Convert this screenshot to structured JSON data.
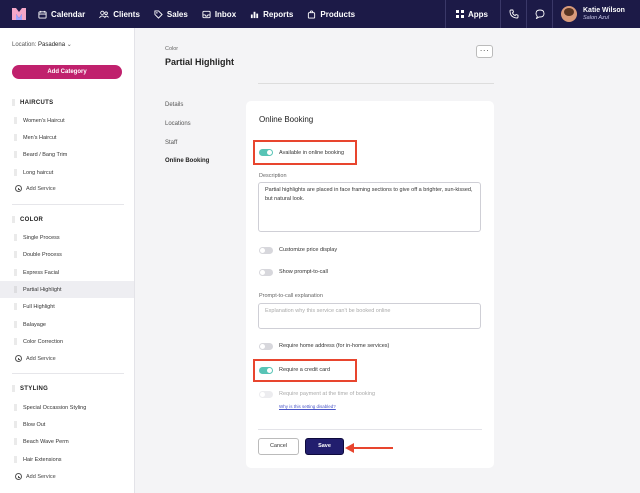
{
  "nav": {
    "items": [
      {
        "label": "Calendar",
        "icon": "calendar-icon"
      },
      {
        "label": "Clients",
        "icon": "clients-icon"
      },
      {
        "label": "Sales",
        "icon": "tag-icon"
      },
      {
        "label": "Inbox",
        "icon": "inbox-icon"
      },
      {
        "label": "Reports",
        "icon": "chart-icon"
      },
      {
        "label": "Products",
        "icon": "bag-icon"
      }
    ],
    "apps_label": "Apps",
    "user_name": "Katie Wilson",
    "user_business": "Salon Azul"
  },
  "sidebar": {
    "location_label": "Location:",
    "location_value": "Pasadena",
    "add_category": "Add Category",
    "add_service": "Add Service",
    "groups": [
      {
        "title": "HAIRCUTS",
        "items": [
          "Women's Haircut",
          "Men's Haircut",
          "Beard / Bang Trim",
          "Long haircut"
        ]
      },
      {
        "title": "COLOR",
        "items": [
          "Single Process",
          "Double Process",
          "Express Facial",
          "Partial Highlight",
          "Full Highlight",
          "Balayage",
          "Color Correction"
        ]
      },
      {
        "title": "STYLING",
        "items": [
          "Special Occassion Styling",
          "Blow Out",
          "Beach Wave Perm",
          "Hair Extensions"
        ]
      }
    ],
    "active_item": "Partial Highlight"
  },
  "main": {
    "category": "Color",
    "title": "Partial Highlight",
    "more_label": "···",
    "subnav": [
      "Details",
      "Locations",
      "Staff",
      "Online Booking"
    ],
    "active_subnav": "Online Booking"
  },
  "card": {
    "title": "Online Booking",
    "available_label": "Available in online booking",
    "available_on": true,
    "description_label": "Description",
    "description_value": "Partial highlights are placed in face framing sections to give off a brighter, sun-kissed, but natural look.",
    "customize_label": "Customize price display",
    "customize_on": false,
    "prompt_label": "Show prompt-to-call",
    "prompt_on": false,
    "prompt_expl_label": "Prompt-to-call explanation",
    "prompt_expl_placeholder": "Explanation why this service can't be booked online",
    "home_label": "Require home address (for in-home services)",
    "home_on": false,
    "credit_label": "Require a credit card",
    "credit_on": true,
    "payment_label": "Require payment at the time of booking",
    "payment_on": false,
    "payment_link": "Why is this setting disabled?",
    "cancel_label": "Cancel",
    "save_label": "Save"
  },
  "colors": {
    "nav_bg": "#1c1a47",
    "accent_pink": "#c0216d",
    "toggle_on": "#58c4b6",
    "save_bg": "#221e6e",
    "highlight": "#e8452e"
  }
}
